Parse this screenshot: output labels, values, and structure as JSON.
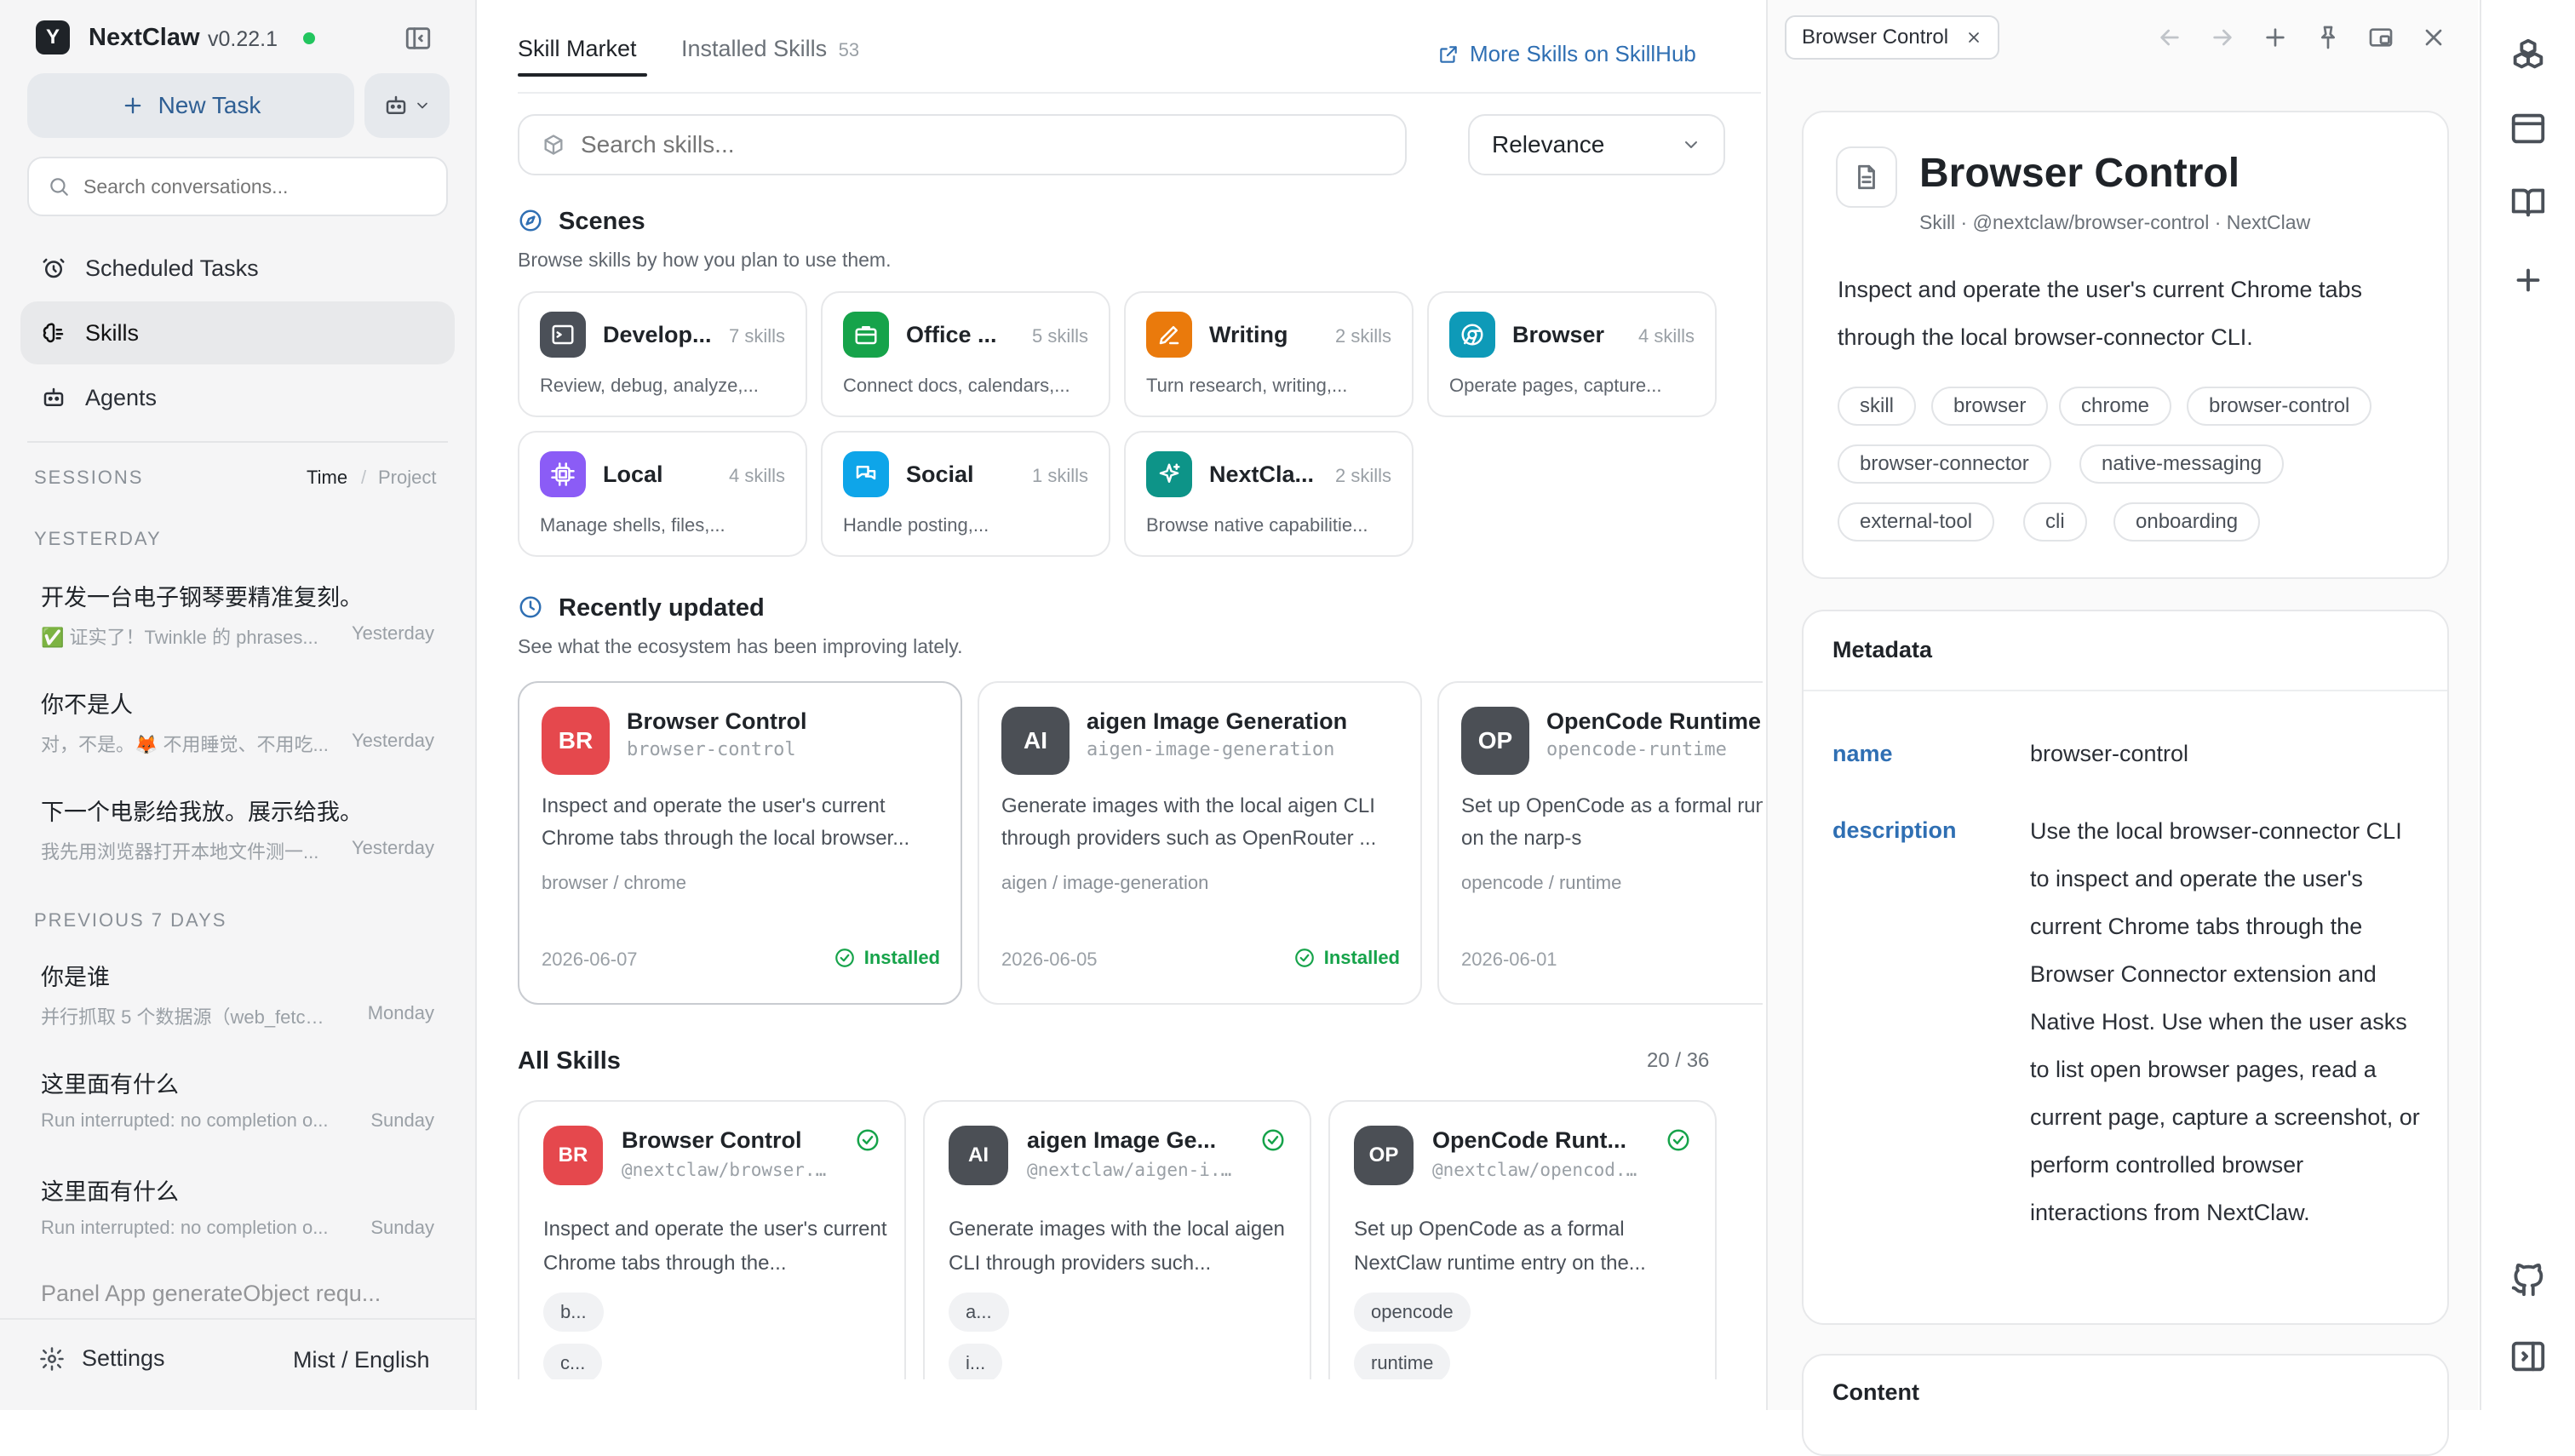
{
  "app": {
    "name": "NextClaw",
    "version": "v0.22.1"
  },
  "sidebar": {
    "new_task": "New Task",
    "search_placeholder": "Search conversations...",
    "nav": [
      {
        "label": "Scheduled Tasks",
        "icon": "alarm-clock-icon"
      },
      {
        "label": "Skills",
        "icon": "brain-icon",
        "active": true
      },
      {
        "label": "Agents",
        "icon": "robot-icon"
      }
    ],
    "sessions_label": "SESSIONS",
    "sort_time": "Time",
    "sort_sep": "/",
    "sort_project": "Project",
    "yesterday_label": "YESTERDAY",
    "prev7_label": "PREVIOUS 7 DAYS",
    "sessions_yesterday": [
      {
        "title": "开发一台电子钢琴要精准复刻。",
        "preview": "✅ 证实了！Twinkle 的 phrases...",
        "time": "Yesterday"
      },
      {
        "title": "你不是人",
        "preview": "对，不是。🦊 不用睡觉、不用吃...",
        "time": "Yesterday"
      },
      {
        "title": "下一个电影给我放。展示给我。",
        "preview": "我先用浏览器打开本地文件测一...",
        "time": "Yesterday"
      }
    ],
    "sessions_prev": [
      {
        "title": "你是谁",
        "preview": "并行抓取 5 个数据源（web_fetch ...",
        "time": "Monday"
      },
      {
        "title": "这里面有什么",
        "preview": "Run interrupted: no completion o...",
        "time": "Sunday"
      },
      {
        "title": "这里面有什么",
        "preview": "Run interrupted: no completion o...",
        "time": "Sunday"
      },
      {
        "title": "Panel App generateObject requ...",
        "preview": "",
        "time": ""
      }
    ],
    "settings": "Settings",
    "theme_lang": "Mist / English"
  },
  "main": {
    "tabs": {
      "market": "Skill Market",
      "installed": "Installed Skills",
      "installed_count": "53"
    },
    "more_link": "More Skills on SkillHub",
    "search_placeholder": "Search skills...",
    "sort_value": "Relevance",
    "scenes_title": "Scenes",
    "scenes_sub": "Browse skills by how you plan to use them.",
    "scenes": [
      {
        "name": "Develop...",
        "count": "7 skills",
        "desc": "Review, debug, analyze,...",
        "color": "#4b5058"
      },
      {
        "name": "Office ...",
        "count": "5 skills",
        "desc": "Connect docs, calendars,...",
        "color": "#16a34a"
      },
      {
        "name": "Writing",
        "count": "2 skills",
        "desc": "Turn research, writing,...",
        "color": "#ea7a0c"
      },
      {
        "name": "Browser",
        "count": "4 skills",
        "desc": "Operate pages, capture...",
        "color": "#0e9ab8"
      },
      {
        "name": "Local",
        "count": "4 skills",
        "desc": "Manage shells, files,...",
        "color": "#8b5cf6"
      },
      {
        "name": "Social",
        "count": "1 skills",
        "desc": "Handle posting,...",
        "color": "#0ea5e9"
      },
      {
        "name": "NextCla...",
        "count": "2 skills",
        "desc": "Browse native capabilitie...",
        "color": "#0d9488"
      }
    ],
    "recent_title": "Recently updated",
    "recent_sub": "See what the ecosystem has been improving lately.",
    "recent": [
      {
        "abbr": "BR",
        "name": "Browser Control",
        "slug": "browser-control",
        "desc": "Inspect and operate the user's current Chrome tabs through the local browser...",
        "tags": "browser / chrome",
        "date": "2026-06-07",
        "status": "Installed",
        "color": "#e5484d"
      },
      {
        "abbr": "AI",
        "name": "aigen Image Generation",
        "slug": "aigen-image-generation",
        "desc": "Generate images with the local aigen CLI through providers such as OpenRouter ...",
        "tags": "aigen / image-generation",
        "date": "2026-06-05",
        "status": "Installed",
        "color": "#4b4f55"
      },
      {
        "abbr": "OP",
        "name": "OpenCode Runtime",
        "slug": "opencode-runtime",
        "desc": "Set up OpenCode as a formal runtime entry on the narp-s",
        "tags": "opencode / runtime",
        "date": "2026-06-01",
        "status": "",
        "color": "#4b4f55"
      }
    ],
    "all_title": "All Skills",
    "all_count": "20 / 36",
    "all": [
      {
        "abbr": "BR",
        "name": "Browser Control",
        "slug": "@nextclaw/browser...",
        "desc": "Inspect and operate the user's current Chrome tabs through the...",
        "chips": [
          "b...",
          "c..."
        ],
        "color": "#e5484d"
      },
      {
        "abbr": "AI",
        "name": "aigen Image Ge...",
        "slug": "@nextclaw/aigen-i...",
        "desc": "Generate images with the local aigen CLI through providers such...",
        "chips": [
          "a...",
          "i..."
        ],
        "color": "#4b4f55"
      },
      {
        "abbr": "OP",
        "name": "OpenCode Runt...",
        "slug": "@nextclaw/opencod...",
        "desc": "Set up OpenCode as a formal NextClaw runtime entry on the...",
        "chips": [
          "opencode",
          "runtime"
        ],
        "color": "#4b4f55"
      }
    ]
  },
  "panel": {
    "tab_label": "Browser Control",
    "title": "Browser Control",
    "subtitle": "Skill · @nextclaw/browser-control · NextClaw",
    "description": "Inspect and operate the user's current Chrome tabs through the local browser-connector CLI.",
    "tags": [
      "skill",
      "browser",
      "chrome",
      "browser-control",
      "browser-connector",
      "native-messaging",
      "external-tool",
      "cli",
      "onboarding"
    ],
    "metadata_title": "Metadata",
    "meta_name_key": "name",
    "meta_name_val": "browser-control",
    "meta_desc_key": "description",
    "meta_desc_val": "Use the local browser-connector CLI to inspect and operate the user's current Chrome tabs through the Browser Connector extension and Native Host. Use when the user asks to list open browser pages, read a current page, capture a screenshot, or perform controlled browser interactions from NextClaw.",
    "content_title": "Content"
  },
  "colors": {
    "accent": "#2f6fb3",
    "installed": "#16a34a",
    "status_dot": "#22c55e"
  }
}
